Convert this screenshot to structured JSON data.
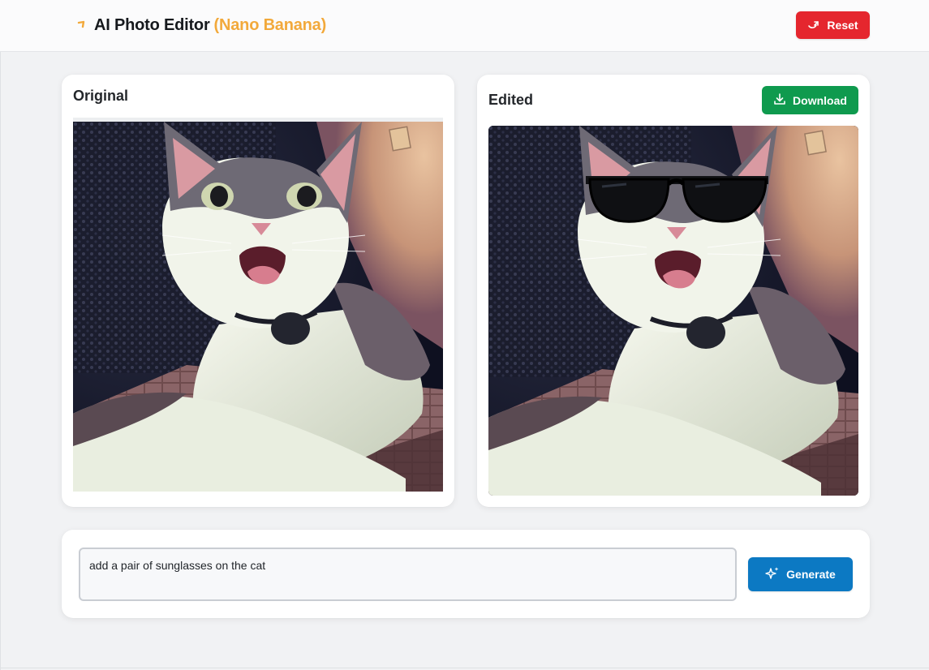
{
  "header": {
    "title": "AI Photo Editor",
    "subtitle": "(Nano Banana)",
    "brand_icon": "banana-icon",
    "reset_label": "Reset",
    "reset_icon": "reset-icon"
  },
  "original_panel": {
    "title": "Original",
    "image": "cat-photo"
  },
  "edited_panel": {
    "title": "Edited",
    "download_label": "Download",
    "download_icon": "download-icon",
    "image": "cat-photo-with-sunglasses"
  },
  "prompt": {
    "value": "add a pair of sunglasses on the cat",
    "generate_label": "Generate",
    "generate_icon": "sparkles-icon"
  },
  "colors": {
    "accent_orange": "#f2a93b",
    "reset_red": "#e5262e",
    "download_green": "#0f9a4e",
    "generate_blue": "#0c79c3",
    "background": "#f1f2f4"
  }
}
